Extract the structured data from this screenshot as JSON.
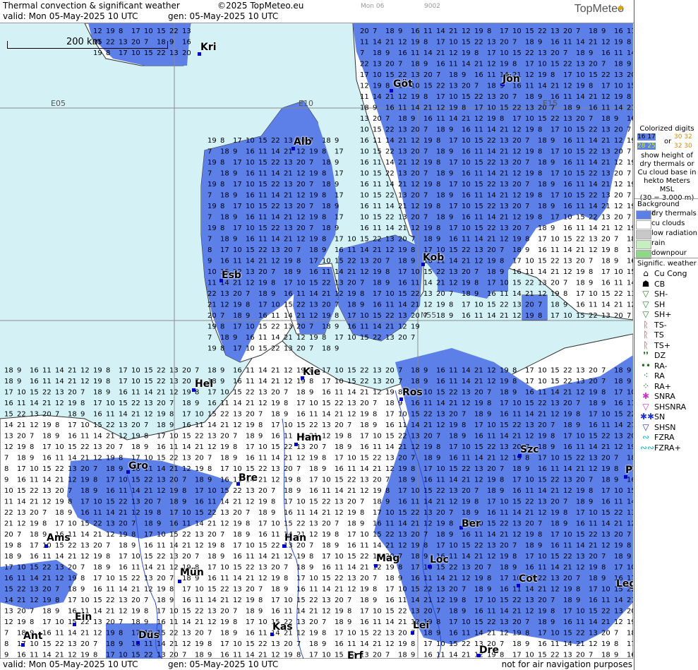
{
  "header": {
    "title": "Thermal convection & significant weather",
    "copyright": "©2025 TopMeteo.eu",
    "valid": "valid:  Mon  05-May-2025  10 UTC",
    "gen": "gen: 05-May-2025 10 UTC",
    "small_day": "Mon 06",
    "small_code": "9002",
    "logo": "TopMeteo",
    "logo_star": "✦"
  },
  "map": {
    "scale_label": "200 km",
    "grid_labels": {
      "e05": "E05",
      "e10": "E10",
      "e15": "E15",
      "n55": "N55"
    },
    "cities": [
      {
        "id": "kri",
        "name": "Kri"
      },
      {
        "id": "got",
        "name": "Göt"
      },
      {
        "id": "jon",
        "name": "Jön"
      },
      {
        "id": "alb",
        "name": "Alb"
      },
      {
        "id": "esb",
        "name": "Esb"
      },
      {
        "id": "kob",
        "name": "Kob"
      },
      {
        "id": "kie",
        "name": "Kie"
      },
      {
        "id": "hel",
        "name": "Hel"
      },
      {
        "id": "ros",
        "name": "Ros"
      },
      {
        "id": "ham",
        "name": "Ham"
      },
      {
        "id": "szc",
        "name": "Szc"
      },
      {
        "id": "gro",
        "name": "Gro"
      },
      {
        "id": "bre",
        "name": "Bre"
      },
      {
        "id": "ber",
        "name": "Ber"
      },
      {
        "id": "ams",
        "name": "Ams"
      },
      {
        "id": "han",
        "name": "Han"
      },
      {
        "id": "mag",
        "name": "Mag"
      },
      {
        "id": "loc",
        "name": "Loc"
      },
      {
        "id": "mun",
        "name": "Mün"
      },
      {
        "id": "cot",
        "name": "Cot"
      },
      {
        "id": "ein",
        "name": "Ein"
      },
      {
        "id": "kas",
        "name": "Kas"
      },
      {
        "id": "lei",
        "name": "Lei"
      },
      {
        "id": "ant",
        "name": "Ant"
      },
      {
        "id": "dus",
        "name": "Düs"
      },
      {
        "id": "dre",
        "name": "Dre"
      },
      {
        "id": "erf",
        "name": "Erf"
      },
      {
        "id": "leg",
        "name": "Leg"
      },
      {
        "id": "p",
        "name": "P"
      }
    ],
    "sample_values": [
      "12",
      "13",
      "14",
      "15",
      "16",
      "17",
      "18",
      "19",
      "20",
      "21",
      "22",
      "11",
      "10",
      "9",
      "8",
      "7"
    ]
  },
  "footer": {
    "valid": "valid:  Mon  05-May-2025  10 UTC",
    "gen": "gen: 05-May-2025 10 UTC",
    "note": "not for air navigation purposes"
  },
  "legend": {
    "colorized_title": "Colorized digits",
    "sample_a": "16 17",
    "sample_b": "30 32",
    "or": "or",
    "sample_c": "28 25",
    "sample_d": "32 30",
    "description": "show height of dry thermals or Cu cloud base in hekto Meters MSL",
    "example": "(30 = 3.000 m)",
    "background_title": "Background color",
    "background_items": [
      {
        "label": "dry thermals",
        "color": "#5c7fe8"
      },
      {
        "label": "cu clouds",
        "color": "#ffffff"
      },
      {
        "label": "low radiation",
        "color": "#c8c8c8"
      },
      {
        "label": "rain",
        "color": "#c6eec0"
      },
      {
        "label": "downpour",
        "color": "#8ed68a"
      }
    ],
    "sigwx_title": "Signific. weather",
    "sigwx_items": [
      {
        "label": "Cu Cong",
        "icon": "cu-cong-icon",
        "glyph": "⌂",
        "color": "#000000"
      },
      {
        "label": "CB",
        "icon": "cb-icon",
        "glyph": "☗",
        "color": "#000000"
      },
      {
        "label": "SH-",
        "icon": "shower-light-icon",
        "glyph": "▽",
        "color": "#2e8b2e"
      },
      {
        "label": "SH",
        "icon": "shower-icon",
        "glyph": "▽",
        "color": "#2e8b2e"
      },
      {
        "label": "SH+",
        "icon": "shower-heavy-icon",
        "glyph": "▽",
        "color": "#2e8b2e"
      },
      {
        "label": "TS-",
        "icon": "thunderstorm-light-icon",
        "glyph": "ᚱ",
        "color": "#d42020"
      },
      {
        "label": "TS",
        "icon": "thunderstorm-icon",
        "glyph": "ᚱ",
        "color": "#d42020"
      },
      {
        "label": "TS+",
        "icon": "thunderstorm-heavy-icon",
        "glyph": "ᚱ",
        "color": "#d42020"
      },
      {
        "label": "DZ",
        "icon": "drizzle-icon",
        "glyph": "❜❜",
        "color": "#1a6b1a"
      },
      {
        "label": "RA-",
        "icon": "rain-light-icon",
        "glyph": "••",
        "color": "#1a6b1a"
      },
      {
        "label": "RA",
        "icon": "rain-icon",
        "glyph": "⁖",
        "color": "#1a6b1a"
      },
      {
        "label": "RA+",
        "icon": "rain-heavy-icon",
        "glyph": "⁘",
        "color": "#1a6b1a"
      },
      {
        "label": "SNRA",
        "icon": "snow-rain-icon",
        "glyph": "✱",
        "color": "#cc33cc"
      },
      {
        "label": "SHSNRA",
        "icon": "snow-rain-shower-icon",
        "glyph": "▽",
        "color": "#cc33cc"
      },
      {
        "label": "SN",
        "icon": "snow-icon",
        "glyph": "✱✱",
        "color": "#2233cc"
      },
      {
        "label": "SHSN",
        "icon": "snow-shower-icon",
        "glyph": "▽",
        "color": "#2233cc"
      },
      {
        "label": "FZRA",
        "icon": "freezing-rain-icon",
        "glyph": "∾",
        "color": "#11b5d6"
      },
      {
        "label": "FZRA+",
        "icon": "freezing-rain-heavy-icon",
        "glyph": "∾∾",
        "color": "#11b5d6"
      }
    ]
  },
  "colors": {
    "sea": "#d4f1f5",
    "dry_thermals": "#5c7fe8",
    "cu_clouds": "#ffffff",
    "grid": "#8a8a8a",
    "coast": "#333333",
    "river": "#2a4bd6"
  }
}
